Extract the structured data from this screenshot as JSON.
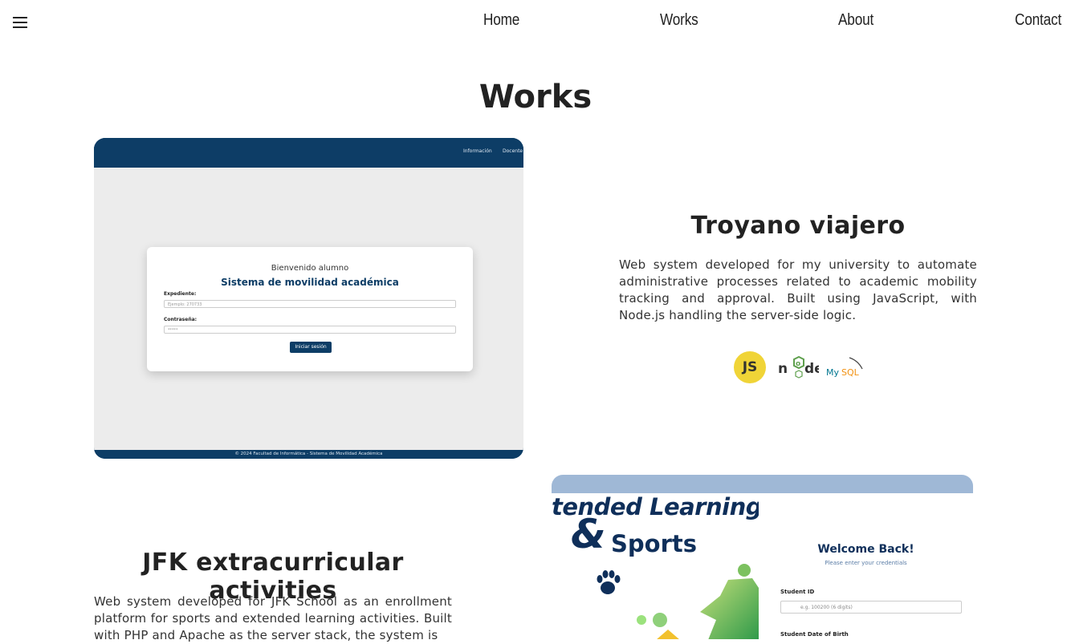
{
  "nav": {
    "items": [
      "Home",
      "Works",
      "About",
      "Contact"
    ]
  },
  "page": {
    "title": "Works"
  },
  "projects": [
    {
      "title": "Troyano viajero",
      "description": "Web system developed for my university to automate administrative processes related to academic mobility tracking and approval. Built using JavaScript, with Node.js handling the server-side logic.",
      "tech": [
        "JS",
        "node",
        "MySQL"
      ],
      "screenshot": {
        "nav_links": [
          "Información",
          "Docente"
        ],
        "welcome": "Bienvenido alumno",
        "system_title": "Sistema de movilidad académica",
        "field1_label": "Expediente:",
        "field1_placeholder": "Ejemplo: 270733",
        "field2_label": "Contraseña:",
        "field2_placeholder": "*****",
        "button": "Iniciar sesión",
        "footer": "© 2024 Facultad de Informática - Sistema de Movilidad Académica"
      }
    },
    {
      "title": "JFK extracurricular activities",
      "description": "Web system developed for JFK School as an enrollment platform for sports and extended learning activities. Built with PHP and Apache as the server stack, the system is",
      "screenshot": {
        "hero_line1": "tended Learning",
        "hero_amp": "&",
        "hero_line2": "Sports",
        "welcome": "Welcome Back!",
        "subtitle": "Please enter your credentials",
        "field1_label": "Student ID",
        "field1_placeholder": "e.g. 100200 (6 digits)",
        "field2_label": "Student Date of Birth"
      }
    }
  ],
  "colors": {
    "navy": "#0d3d66",
    "js_yellow": "#f0d437",
    "node_green": "#5fa04e"
  }
}
